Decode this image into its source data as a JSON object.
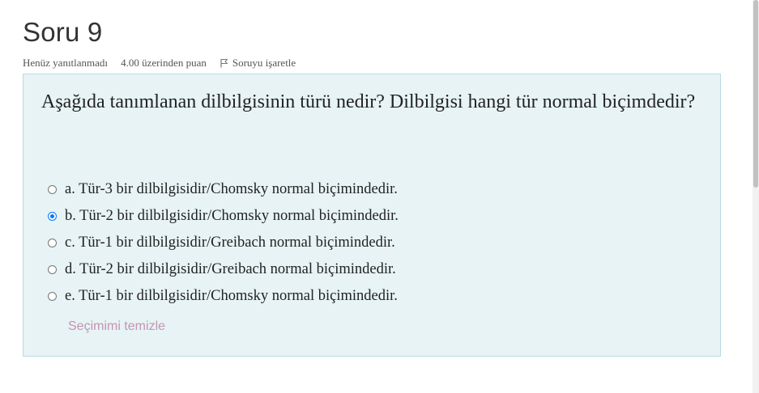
{
  "question": {
    "title": "Soru 9",
    "status": "Henüz yanıtlanmadı",
    "points": "4.00 üzerinden puan",
    "flag_label": "Soruyu işaretle",
    "flag_icon": "flag-icon",
    "text": "Aşağıda tanımlanan dilbilgisinin türü nedir? Dilbilgisi hangi tür normal biçimdedir?",
    "answers": [
      {
        "label": "a. Tür-3 bir dilbilgisidir/Chomsky normal biçimindedir.",
        "selected": false
      },
      {
        "label": "b. Tür-2 bir dilbilgisidir/Chomsky normal biçimindedir.",
        "selected": true
      },
      {
        "label": "c. Tür-1 bir dilbilgisidir/Greibach normal biçimindedir.",
        "selected": false
      },
      {
        "label": "d. Tür-2 bir dilbilgisidir/Greibach normal biçimindedir.",
        "selected": false
      },
      {
        "label": "e. Tür-1 bir dilbilgisidir/Chomsky normal biçimindedir.",
        "selected": false
      }
    ],
    "clear_label": "Seçimimi temizle"
  },
  "colors": {
    "question_background": "#e7f3f5",
    "question_border": "#b8dce2",
    "radio_accent": "#0075ff",
    "clear_link": "#c494b5"
  }
}
